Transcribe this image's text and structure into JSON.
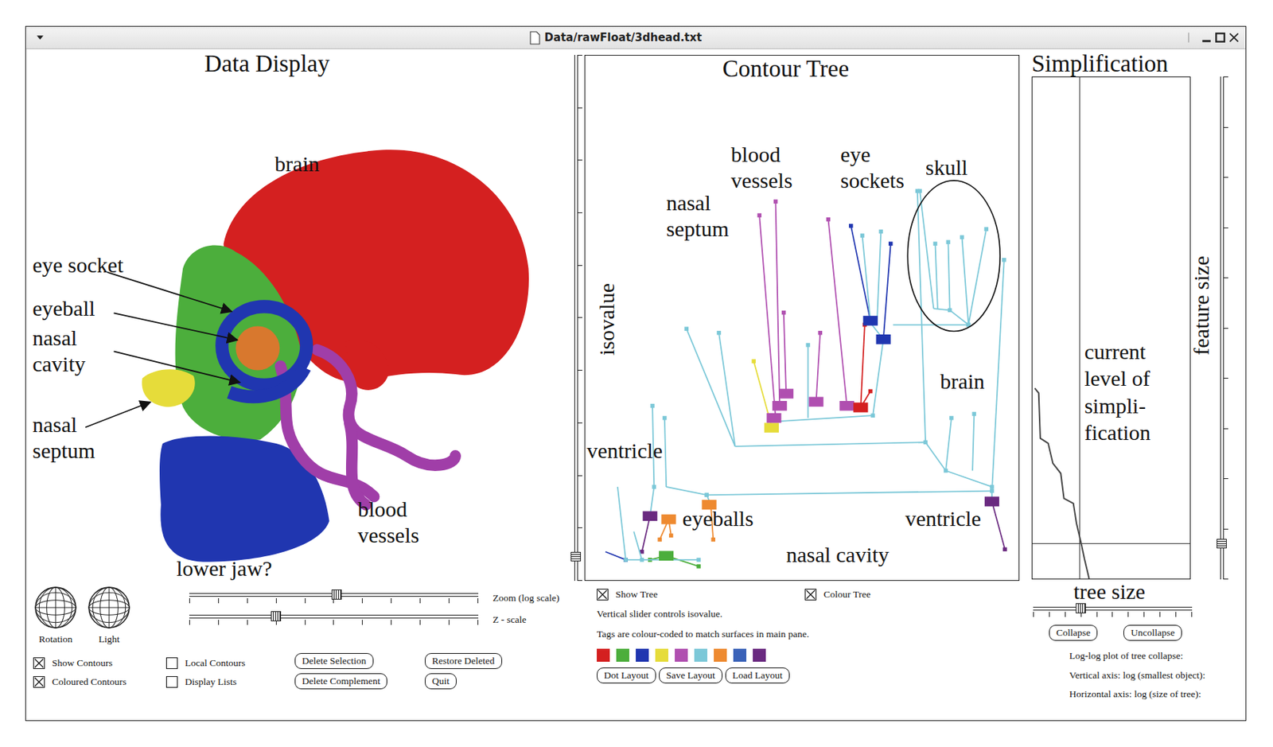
{
  "window": {
    "title": "Data/rawFloat/3dhead.txt"
  },
  "data_display": {
    "heading": "Data Display",
    "structures": [
      {
        "label": "brain",
        "kind": "single",
        "color": "#d42020"
      },
      {
        "label": "eye socket",
        "kind": "single",
        "color": "#2036b0"
      },
      {
        "label": "eyeball",
        "kind": "single",
        "color": "#d8782e"
      },
      {
        "label": "nasal cavity",
        "kind": "stacked",
        "color": "#4cae3c"
      },
      {
        "label": "nasal septum",
        "kind": "stacked",
        "color": "#e6dc3a"
      },
      {
        "label": "blood vessels",
        "kind": "stacked",
        "color": "#a03ea8"
      },
      {
        "label": "lower jaw?",
        "kind": "single",
        "color": "#2036b0"
      }
    ],
    "trackballs": [
      "Rotation",
      "Light"
    ],
    "sliders": [
      {
        "label": "Zoom (log scale)",
        "level": 0.51
      },
      {
        "label": "Z - scale",
        "level": 0.3
      }
    ],
    "checkboxes": [
      {
        "label": "Show Contours",
        "checked": true
      },
      {
        "label": "Coloured Contours",
        "checked": true
      },
      {
        "label": "Local Contours",
        "checked": false
      },
      {
        "label": "Display Lists",
        "checked": false
      }
    ],
    "buttons": [
      "Delete Selection",
      "Delete Complement",
      "Restore Deleted",
      "Quit"
    ]
  },
  "contour_tree": {
    "heading": "Contour Tree",
    "axis_label": "isovalue",
    "isovalue_level": 0.045,
    "labels": [
      {
        "text": "blood vessels",
        "kind": "stacked"
      },
      {
        "text": "eye sockets",
        "kind": "stacked"
      },
      {
        "text": "skull",
        "kind": "single"
      },
      {
        "text": "nasal septum",
        "kind": "stacked"
      },
      {
        "text": "brain",
        "kind": "single"
      },
      {
        "text": "ventricle",
        "kind": "single"
      },
      {
        "text": "eyeballs",
        "kind": "single"
      },
      {
        "text": "ventricle",
        "kind": "single"
      },
      {
        "text": "nasal cavity",
        "kind": "single"
      }
    ],
    "checkboxes": [
      {
        "label": "Show Tree",
        "checked": true
      },
      {
        "label": "Colour Tree",
        "checked": true
      }
    ],
    "notes": [
      "Vertical slider controls isovalue.",
      "Tags are colour-coded to match surfaces in main pane."
    ],
    "swatches": [
      {
        "color": "#d42020"
      },
      {
        "color": "#4cae3c"
      },
      {
        "color": "#2036b0"
      },
      {
        "color": "#e6dc3a"
      },
      {
        "color": "#b04fb0"
      },
      {
        "color": "#7cc8d8"
      },
      {
        "color": "#ee8a30"
      },
      {
        "color": "#3a62b8"
      },
      {
        "color": "#6a2a80"
      }
    ],
    "buttons": [
      "Dot Layout",
      "Save Layout",
      "Load Layout"
    ]
  },
  "simplification": {
    "heading": "Simplification",
    "axis_label": "feature size",
    "x_label": "tree size",
    "annotation": [
      "current",
      "level of",
      "simpli-",
      "fication"
    ],
    "feature_level": 0.07,
    "tree_level": 0.3,
    "curve": [
      [
        0.015,
        0.62
      ],
      [
        0.04,
        0.63
      ],
      [
        0.05,
        0.72
      ],
      [
        0.1,
        0.73
      ],
      [
        0.13,
        0.77
      ],
      [
        0.18,
        0.79
      ],
      [
        0.2,
        0.84
      ],
      [
        0.26,
        0.85
      ],
      [
        0.28,
        0.89
      ],
      [
        0.31,
        0.93
      ],
      [
        0.33,
        0.96
      ],
      [
        0.36,
        1.0
      ]
    ],
    "buttons": [
      "Collapse",
      "Uncollapse"
    ],
    "notes": [
      "Log-log plot of tree collapse:",
      "Vertical axis: log (smallest object):",
      "Horizontal axis: log (size of tree):"
    ]
  }
}
